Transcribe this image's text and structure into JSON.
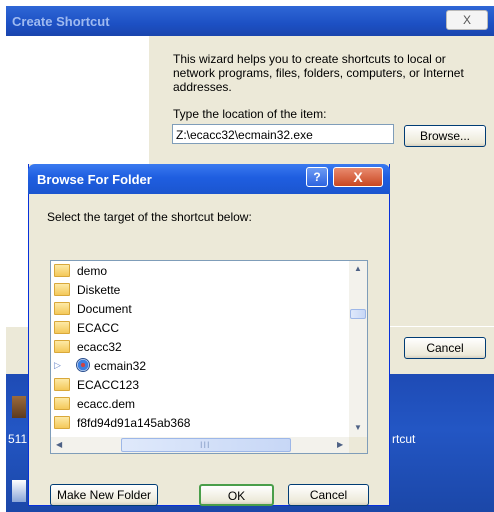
{
  "background_window": {
    "title": "Create Shortcut",
    "close_glyph": "X",
    "description": "This wizard helps you to create shortcuts to local or network programs, files, folders, computers, or Internet addresses.",
    "location_label": "Type the location of the item:",
    "location_value": "Z:\\ecacc32\\ecmain32.exe",
    "browse_label": "Browse...",
    "cancel_label": "Cancel",
    "desktop_text_left": "511",
    "desktop_text_right": "rtcut"
  },
  "dialog": {
    "title": "Browse For Folder",
    "help_glyph": "?",
    "close_glyph": "X",
    "instruction": "Select the target of the shortcut below:",
    "tree_items": [
      {
        "label": "demo",
        "icon": "folder-icon"
      },
      {
        "label": "Diskette",
        "icon": "folder-icon"
      },
      {
        "label": "Document",
        "icon": "folder-icon"
      },
      {
        "label": "ECACC",
        "icon": "folder-icon"
      },
      {
        "label": "ecacc32",
        "icon": "folder-icon"
      },
      {
        "label": "ecmain32",
        "icon": "disc-icon",
        "selected": true,
        "expander": "▷"
      },
      {
        "label": "ECACC123",
        "icon": "folder-icon"
      },
      {
        "label": "ecacc.dem",
        "icon": "folder-icon"
      },
      {
        "label": "f8fd94d91a145ab368",
        "icon": "folder-icon"
      }
    ],
    "scroll_up": "▲",
    "scroll_down": "▼",
    "scroll_left": "◀",
    "scroll_right": "▶",
    "grip": "III",
    "buttons": {
      "make_new_folder": "Make New Folder",
      "ok": "OK",
      "cancel": "Cancel"
    }
  },
  "colors": {
    "titlebar_active": "#1f5ee0",
    "dialog_face": "#ece9d8",
    "close_red": "#c94722"
  }
}
